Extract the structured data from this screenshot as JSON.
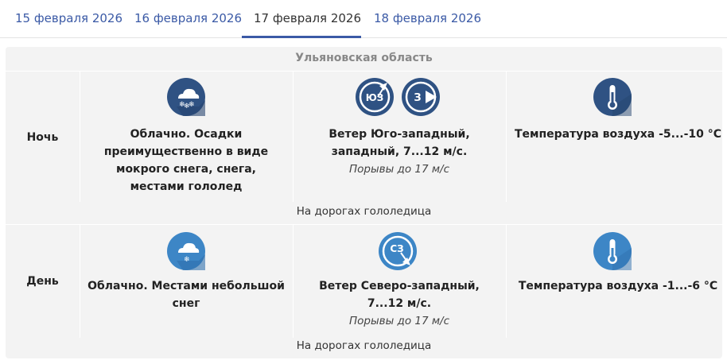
{
  "tabs": [
    {
      "label": "15 февраля 2026",
      "active": false
    },
    {
      "label": "16 февраля 2026",
      "active": false
    },
    {
      "label": "17 февраля 2026",
      "active": true
    },
    {
      "label": "18 февраля 2026",
      "active": false
    }
  ],
  "region": "Ульяновская область",
  "rows": [
    {
      "label": "Ночь",
      "condition_icon": "cloud-snow-icon",
      "condition": "Облачно. Осадки преимущественно в виде мокрого снега, снега, местами гололед",
      "wind_icons": [
        {
          "name": "wind-sw-icon",
          "label": "ЮЗ"
        },
        {
          "name": "wind-w-icon",
          "label": "З"
        }
      ],
      "wind": "Ветер Юго-западный, западный, 7...12 м/с.",
      "gusts": "Порывы до 17 м/с",
      "temp_icon": "thermometer-icon",
      "temperature": "Температура воздуха -5...-10 °C",
      "road": "На дорогах гололедица"
    },
    {
      "label": "День",
      "condition_icon": "cloud-snow-icon",
      "condition": "Облачно. Местами небольшой снег",
      "wind_icons": [
        {
          "name": "wind-nw-icon",
          "label": "СЗ"
        }
      ],
      "wind": "Ветер Северо-западный, 7...12 м/с.",
      "gusts": "Порывы до 17 м/с",
      "temp_icon": "thermometer-icon",
      "temperature": "Температура воздуха -1...-6 °C",
      "road": "На дорогах гололедица"
    }
  ],
  "colors": {
    "accent": "#3b5aa6",
    "night_icon": "#2f5283",
    "day_icon": "#3d86c6",
    "panel_bg": "#f3f3f3"
  }
}
